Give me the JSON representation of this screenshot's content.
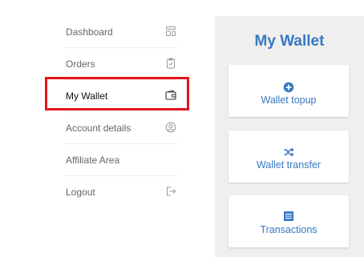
{
  "nav": {
    "items": [
      {
        "label": "Dashboard",
        "icon": "dashboard-icon"
      },
      {
        "label": "Orders",
        "icon": "clipboard-icon"
      },
      {
        "label": "My Wallet",
        "icon": "wallet-icon",
        "active": true
      },
      {
        "label": "Account details",
        "icon": "user-circle-icon"
      },
      {
        "label": "Affiliate Area",
        "icon": ""
      },
      {
        "label": "Logout",
        "icon": "logout-icon"
      }
    ]
  },
  "wallet": {
    "title": "My Wallet",
    "cards": [
      {
        "label": "Wallet topup",
        "icon": "plus-circle-icon"
      },
      {
        "label": "Wallet transfer",
        "icon": "shuffle-icon"
      },
      {
        "label": "Transactions",
        "icon": "list-icon"
      }
    ]
  },
  "colors": {
    "accent": "#3778c2",
    "highlight": "#e3151b",
    "panel_bg": "#efefef",
    "nav_text": "#666666"
  }
}
